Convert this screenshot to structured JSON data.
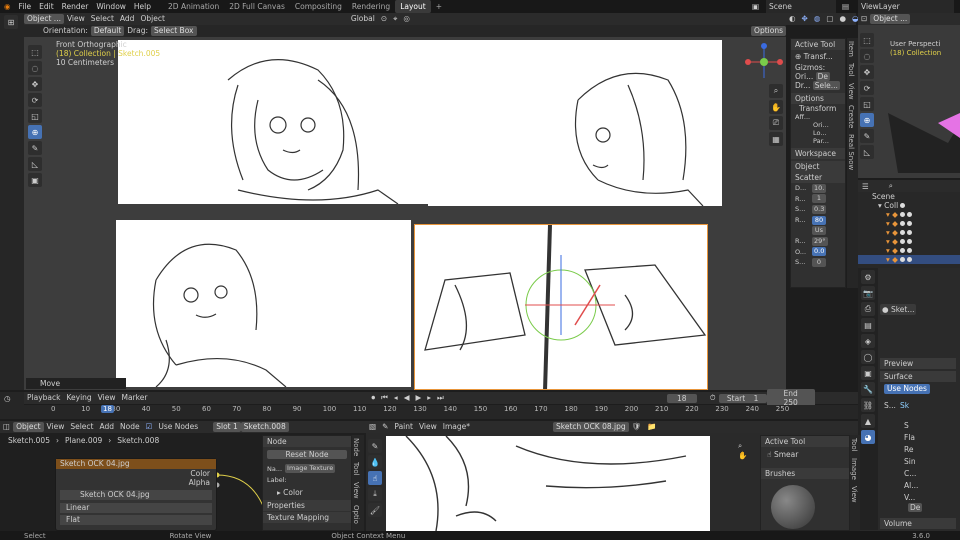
{
  "menu": [
    "File",
    "Edit",
    "Render",
    "Window",
    "Help"
  ],
  "workspaces": [
    "2D Animation",
    "2D Full Canvas",
    "Compositing",
    "Rendering",
    "Layout"
  ],
  "active_workspace": "Layout",
  "scene": "Scene",
  "view_layer": "ViewLayer",
  "viewport": {
    "mode": "Object ...",
    "menus": [
      "View",
      "Select",
      "Add",
      "Object"
    ],
    "orientation_label": "Orientation:",
    "orientation_value": "Default",
    "drag_label": "Drag:",
    "drag_value": "Select Box",
    "transform_space": "Global",
    "options": "Options",
    "info_title": "Front Orthographic",
    "info_collection": "(18) Collection | Sketch.005",
    "info_scale": "10 Centimeters",
    "operator": "Move"
  },
  "n_panel": {
    "active_tool": "Active Tool",
    "transf": "Transf...",
    "gizmos": "Gizmos:",
    "ori": "Ori...",
    "de": "De",
    "dr": "Dr...",
    "sele": "Sele...",
    "options": "Options",
    "transform": "Transform",
    "aff": "Aff...",
    "ori2": "Ori...",
    "lo": "Lo...",
    "par": "Par...",
    "workspace": "Workspace",
    "object_scatter": "Object Scatter",
    "rows": [
      {
        "k": "D...",
        "v": "10."
      },
      {
        "k": "R...",
        "v": "1"
      },
      {
        "k": "S...",
        "v": "0.3"
      },
      {
        "k": "R...",
        "v": "80"
      },
      {
        "k": "",
        "v": "Us"
      },
      {
        "k": "R...",
        "v": "29°"
      },
      {
        "k": "O...",
        "v": "0.0"
      },
      {
        "k": "S...",
        "v": "0"
      }
    ],
    "tabs": [
      "Item",
      "Tool",
      "View",
      "Create",
      "Real Snow"
    ]
  },
  "mini_viewport": {
    "label": "User Perspecti",
    "collection": "(18) Collection"
  },
  "outliner": {
    "scene": "Scene",
    "coll": "Coll",
    "rows": [
      "",
      "",
      "",
      "",
      "",
      ""
    ]
  },
  "props": {
    "obj": "Sket...",
    "preview": "Preview",
    "surface": "Surface",
    "use_nodes": "Use Nodes",
    "s": "S...",
    "sk": "Sk",
    "rows": [
      "S",
      "Fla",
      "Re",
      "Sin",
      "C...",
      "Al...",
      "V..."
    ],
    "de": "De",
    "volume": "Volume"
  },
  "timeline": {
    "menus": [
      "Playback",
      "Keying",
      "View",
      "Marker"
    ],
    "current": "18",
    "start_label": "Start",
    "start": "1",
    "end_label": "End",
    "end": "250",
    "ticks": [
      "0",
      "10",
      "30",
      "40",
      "50",
      "60",
      "70",
      "80",
      "90",
      "100",
      "110",
      "120",
      "130",
      "140",
      "150",
      "160",
      "170",
      "180",
      "190",
      "200",
      "210",
      "220",
      "230",
      "240",
      "250"
    ],
    "frame_marker": "18"
  },
  "node_editor": {
    "mode": "Object",
    "menus": [
      "View",
      "Select",
      "Add",
      "Node"
    ],
    "use_nodes": "Use Nodes",
    "slot": "Slot 1",
    "material": "Sketch.008",
    "breadcrumb": [
      "Sketch.005",
      "Plane.009",
      "Sketch.008"
    ],
    "node_title": "Sketch OCK 04.jpg",
    "out_color": "Color",
    "out_alpha": "Alpha",
    "image": "Sketch OCK 04.jpg",
    "interp": "Linear",
    "proj": "Flat",
    "side": {
      "node": "Node",
      "reset": "Reset Node",
      "name_label": "Na...",
      "name": "Image Texture",
      "label_label": "Label:",
      "color": "Color",
      "properties": "Properties",
      "texture_mapping": "Texture Mapping"
    },
    "tabs": [
      "Node",
      "Tool",
      "View",
      "Optio"
    ]
  },
  "image_editor": {
    "paint": "Paint",
    "menus": [
      "View",
      "Image*"
    ],
    "image": "Sketch OCK 08.jpg",
    "active_tool": "Active Tool",
    "smear": "Smear",
    "brushes": "Brushes",
    "tabs": [
      "Tool",
      "Image",
      "View"
    ]
  },
  "status": {
    "select": "Select",
    "rotate": "Rotate View",
    "context": "Object Context Menu",
    "version": "3.6.0"
  }
}
